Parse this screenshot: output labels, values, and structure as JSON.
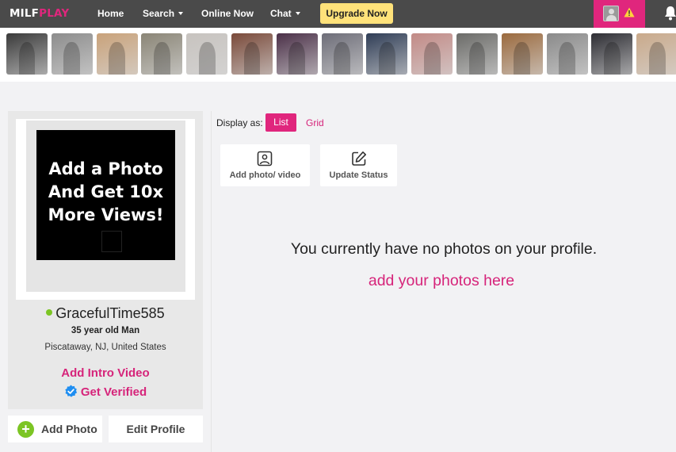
{
  "brand": {
    "logo_main": "MILF",
    "logo_accent": "PLAY",
    "accent_color": "#e0267d"
  },
  "nav": {
    "home": "Home",
    "search": "Search",
    "online_now": "Online Now",
    "chat": "Chat",
    "upgrade": "Upgrade Now"
  },
  "header_icons": {
    "account": "avatar-placeholder-icon",
    "alert": "warning-icon",
    "notifications": "bell-icon"
  },
  "photo_strip": {
    "count": 15,
    "tones": [
      "#3a3a3a",
      "#8c8c8c",
      "#c9a27a",
      "#8a8576",
      "#c7c3bf",
      "#7a4a3a",
      "#4b3048",
      "#6d6d78",
      "#2f3d56",
      "#c28a86",
      "#6b6b68",
      "#9b6a3e",
      "#8a8a8a",
      "#2d2d33",
      "#c9a98a"
    ]
  },
  "profile": {
    "promo_text": [
      "Add a Photo",
      "And Get 10x",
      "More Views!"
    ],
    "username": "GracefulTime585",
    "age_line": "35 year old Man",
    "location": "Piscataway, NJ, United States",
    "intro_video": "Add Intro Video",
    "get_verified": "Get Verified",
    "add_photo": "Add Photo",
    "edit_profile": "Edit Profile"
  },
  "gallery": {
    "display_as": "Display as:",
    "list": "List",
    "grid": "Grid",
    "add_photo_video": "Add photo/ video",
    "update_status": "Update Status",
    "empty_message": "You currently have no photos on your profile.",
    "add_photos_link": "add your photos here"
  }
}
